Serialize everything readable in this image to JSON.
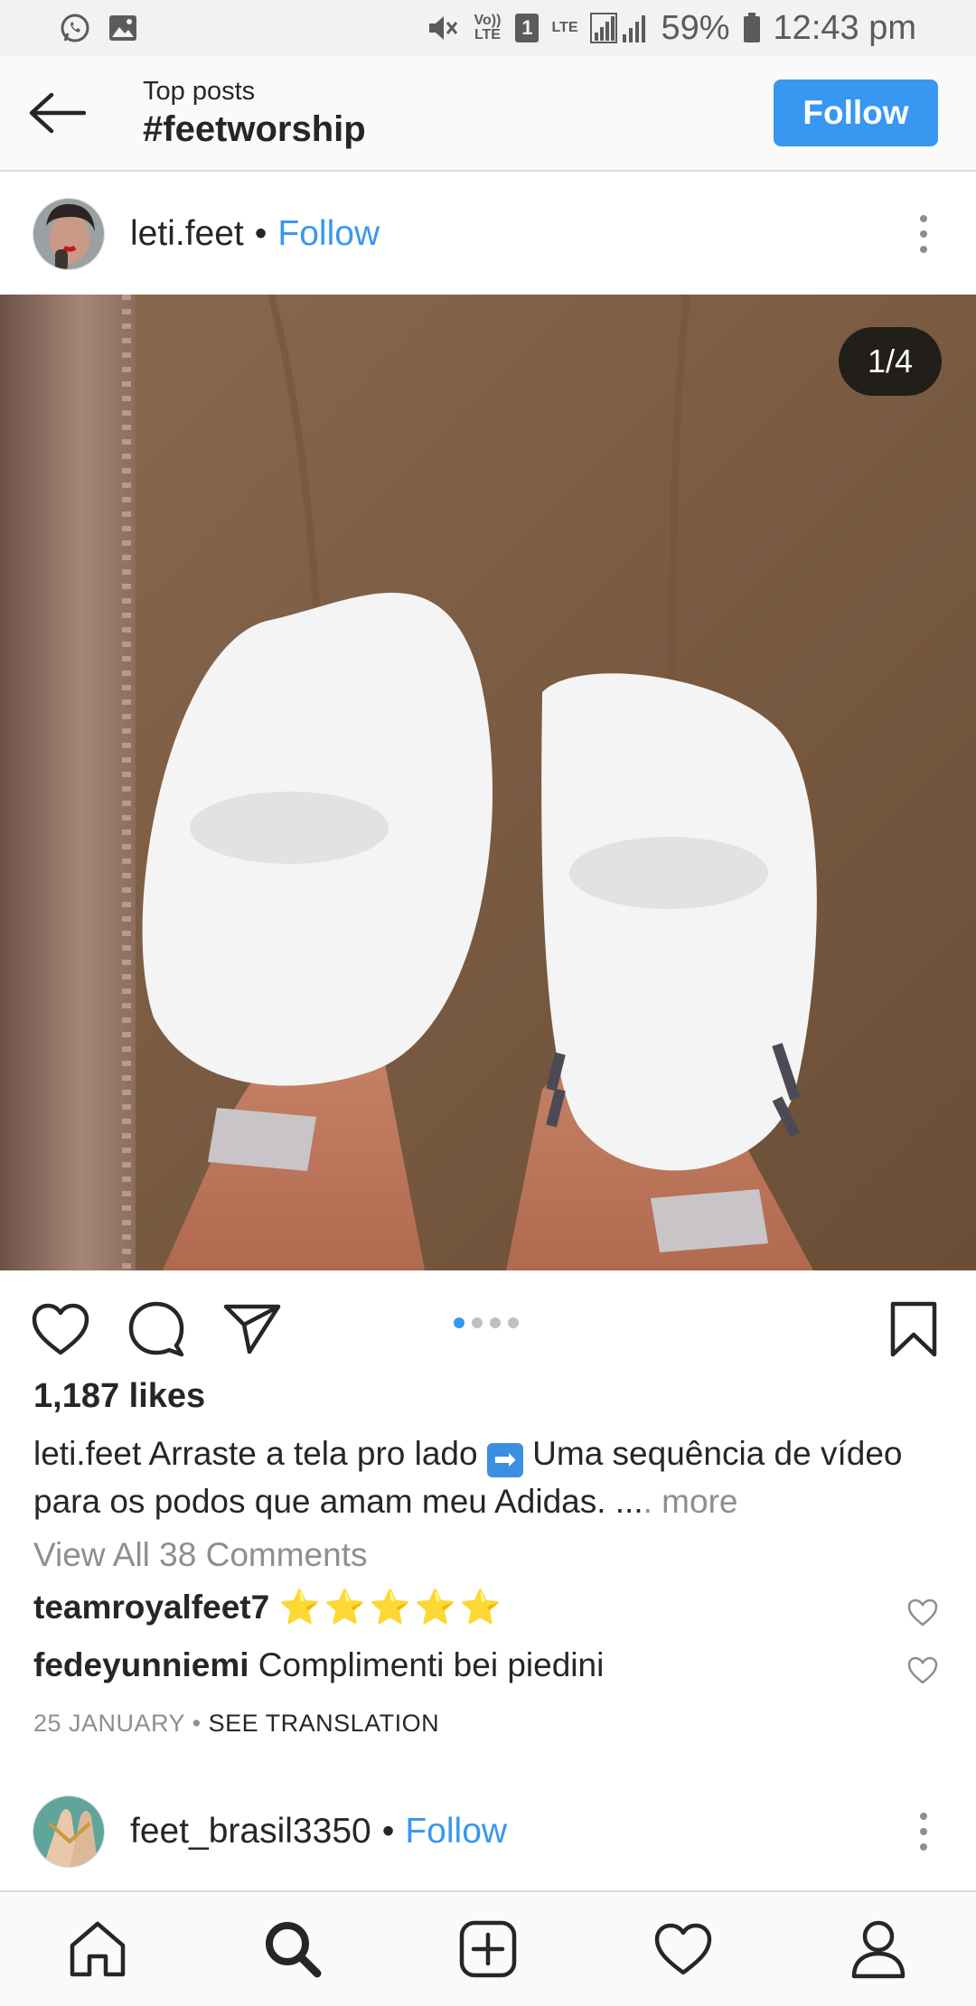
{
  "status_bar": {
    "left_icons": [
      "whatsapp-icon",
      "gallery-icon"
    ],
    "volte_label": "Vo)) LTE",
    "sim_label": "1",
    "network_label": "LTE",
    "battery": "59%",
    "time": "12:43 pm"
  },
  "header": {
    "subtitle": "Top posts",
    "title": "#feetworship",
    "follow_label": "Follow"
  },
  "post": {
    "username": "leti.feet",
    "separator": "•",
    "follow_label": "Follow",
    "counter": "1/4",
    "carousel": {
      "count": 4,
      "active": 0
    },
    "likes": "1,187 likes",
    "caption_user": "leti.feet",
    "caption_text_1": "Arraste a tela pro lado",
    "caption_emoji": "➡",
    "caption_text_2": "Uma sequência de vídeo para os podos que amam meu Adidas. ...",
    "caption_more": ". more",
    "view_all": "View All 38 Comments",
    "comments": [
      {
        "user": "teamroyalfeet7",
        "text": "⭐⭐⭐⭐⭐"
      },
      {
        "user": "fedeyunniemi",
        "text": "Complimenti bei piedini"
      }
    ],
    "date": "25 JANUARY",
    "date_sep": "•",
    "see_translation": "SEE TRANSLATION"
  },
  "post2": {
    "username": "feet_brasil3350",
    "separator": "•",
    "follow_label": "Follow"
  },
  "nav": [
    "home-icon",
    "search-icon",
    "add-post-icon",
    "activity-heart-icon",
    "profile-icon"
  ],
  "colors": {
    "accent": "#3897f0",
    "text": "#262626",
    "muted": "#8e8e8e"
  }
}
